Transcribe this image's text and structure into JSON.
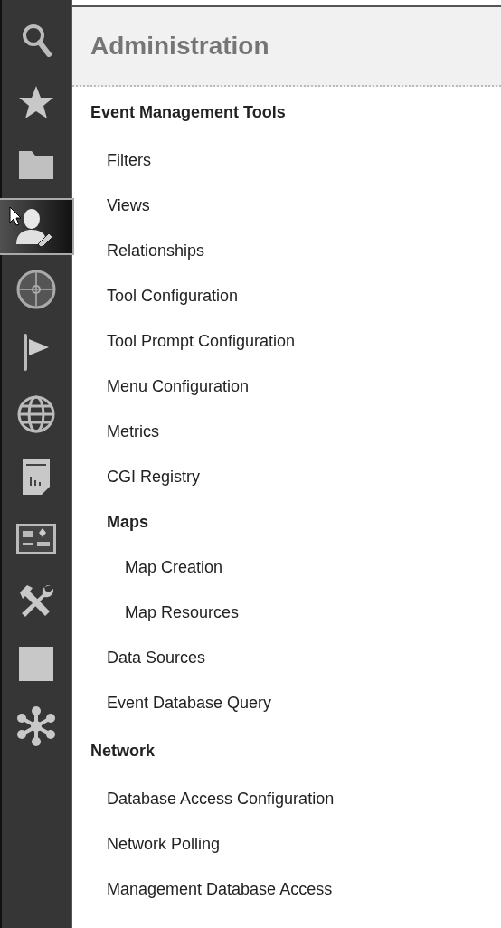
{
  "sidebar": {
    "items": [
      {
        "kind": "search",
        "selected": false
      },
      {
        "kind": "star",
        "selected": false
      },
      {
        "kind": "folder",
        "selected": false
      },
      {
        "kind": "user-edit",
        "selected": true
      },
      {
        "kind": "crosshair",
        "selected": false
      },
      {
        "kind": "flag",
        "selected": false
      },
      {
        "kind": "globe",
        "selected": false
      },
      {
        "kind": "report",
        "selected": false
      },
      {
        "kind": "dashboard",
        "selected": false
      },
      {
        "kind": "tools",
        "selected": false
      },
      {
        "kind": "square",
        "selected": false
      },
      {
        "kind": "asterisk",
        "selected": false
      }
    ]
  },
  "panel": {
    "title": "Administration",
    "sections": [
      {
        "title": "Event Management Tools",
        "items": [
          {
            "label": "Filters"
          },
          {
            "label": "Views"
          },
          {
            "label": "Relationships"
          },
          {
            "label": "Tool Configuration"
          },
          {
            "label": "Tool Prompt Configuration"
          },
          {
            "label": "Menu Configuration"
          },
          {
            "label": "Metrics"
          },
          {
            "label": "CGI Registry"
          },
          {
            "label": "Maps",
            "children": [
              {
                "label": "Map Creation"
              },
              {
                "label": "Map Resources"
              }
            ]
          },
          {
            "label": "Data Sources"
          },
          {
            "label": "Event Database Query"
          }
        ]
      },
      {
        "title": "Network",
        "items": [
          {
            "label": "Database Access Configuration"
          },
          {
            "label": "Network Polling"
          },
          {
            "label": "Management Database Access"
          }
        ]
      }
    ]
  }
}
